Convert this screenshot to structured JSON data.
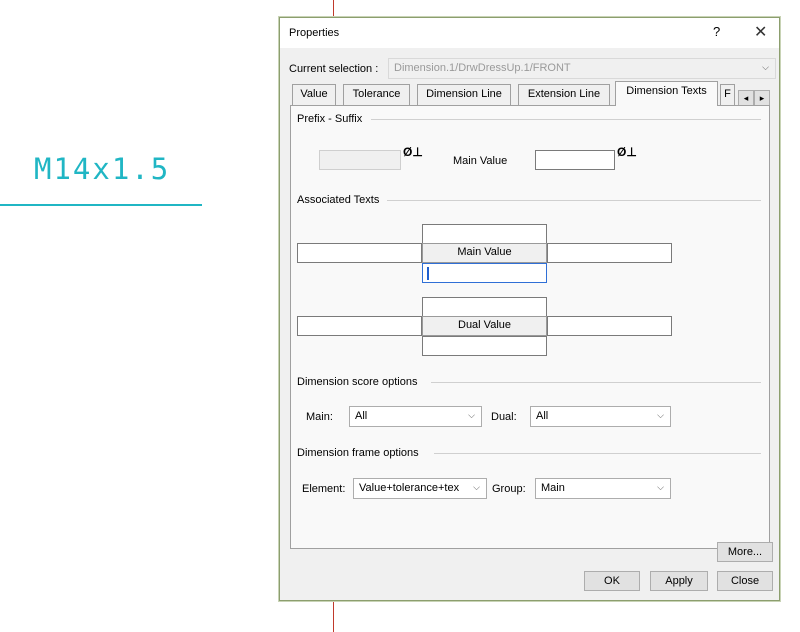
{
  "canvas": {
    "dimension_text": "M14x1.5",
    "dimension_color": "#20b6c4",
    "axis_color": "#c0392b"
  },
  "dialog": {
    "title": "Properties",
    "help_label": "?",
    "close_label": "✕",
    "current_selection_label": "Current selection :",
    "current_selection_value": "Dimension.1/DrwDressUp.1/FRONT",
    "tabs": [
      {
        "label": "Value"
      },
      {
        "label": "Tolerance"
      },
      {
        "label": "Dimension Line"
      },
      {
        "label": "Extension Line"
      },
      {
        "label": "Dimension Texts",
        "active": true
      },
      {
        "label": "F"
      }
    ],
    "tab_scroll_left": "◂",
    "tab_scroll_right": "▸",
    "prefix_suffix": {
      "heading": "Prefix - Suffix",
      "main_value_label": "Main Value",
      "symbol_glyph": "Ø⊥"
    },
    "associated_texts": {
      "heading": "Associated Texts",
      "main_value_caption": "Main Value",
      "dual_value_caption": "Dual Value"
    },
    "score_options": {
      "heading": "Dimension score options",
      "main_label": "Main:",
      "main_value": "All",
      "dual_label": "Dual:",
      "dual_value": "All"
    },
    "frame_options": {
      "heading": "Dimension frame options",
      "element_label": "Element:",
      "element_value": "Value+tolerance+tex",
      "group_label": "Group:",
      "group_value": "Main"
    },
    "buttons": {
      "more": "More...",
      "ok": "OK",
      "apply": "Apply",
      "close": "Close"
    }
  }
}
